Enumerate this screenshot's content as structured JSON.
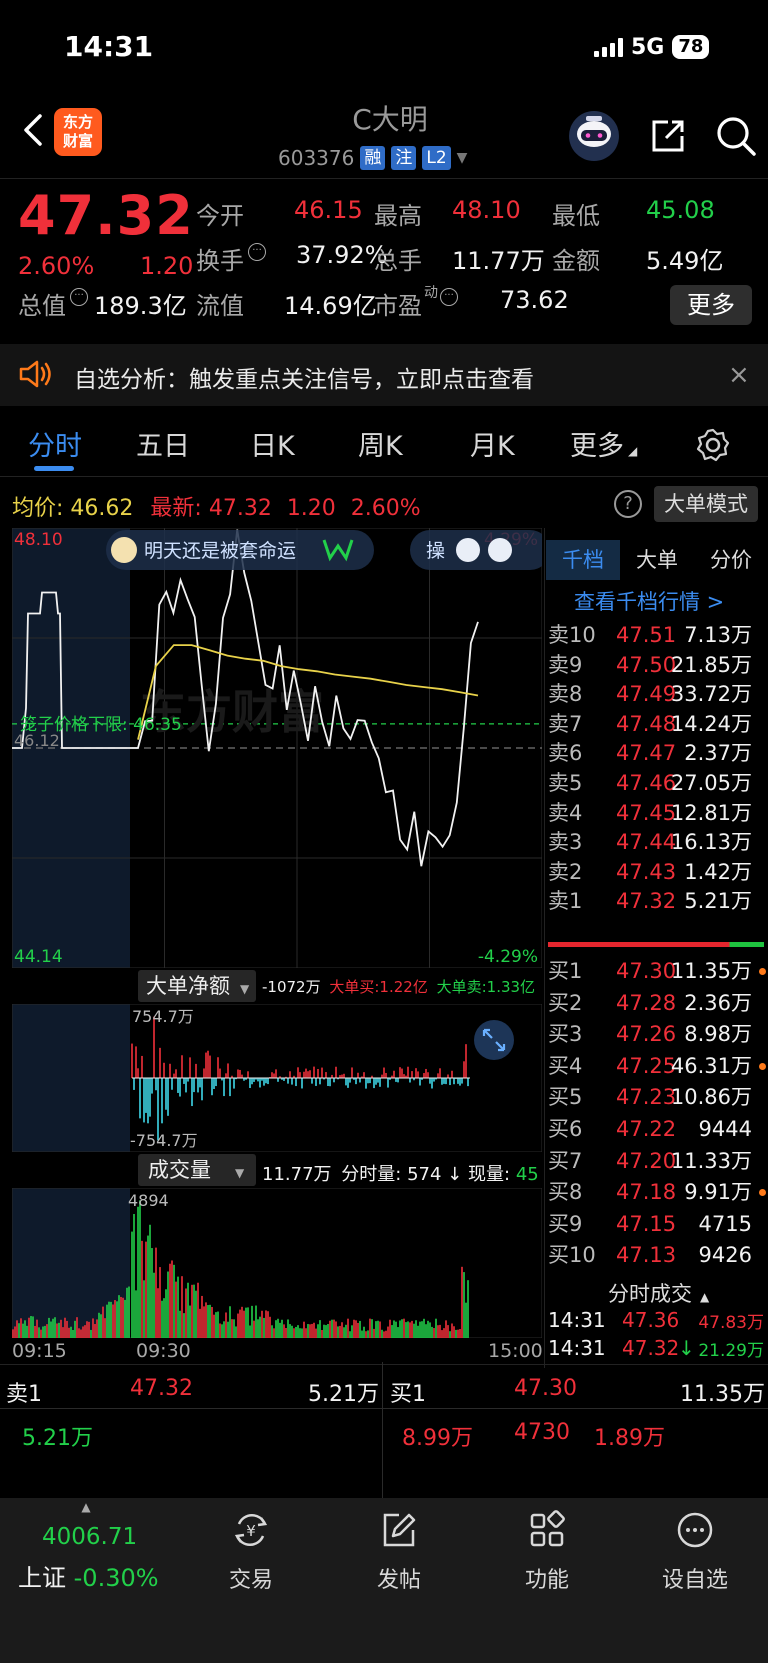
{
  "status": {
    "time": "14:31",
    "network": "5G",
    "battery": "78"
  },
  "header": {
    "app_logo": "东方\n财富",
    "stock_name": "C大明",
    "stock_code": "603376",
    "tags": [
      "融",
      "注",
      "L2"
    ],
    "icons": [
      "chevron-left-icon",
      "robot-avatar-icon",
      "share-icon",
      "search-icon"
    ]
  },
  "quote": {
    "price": "47.32",
    "change_pct": "2.60%",
    "change": "1.20",
    "fields": [
      {
        "label": "今开",
        "value": "46.15",
        "color": "red"
      },
      {
        "label": "最高",
        "value": "48.10",
        "color": "red"
      },
      {
        "label": "最低",
        "value": "45.08",
        "color": "green"
      },
      {
        "label": "换手",
        "value": "37.92%",
        "color": "white"
      },
      {
        "label": "总手",
        "value": "11.77万",
        "color": "white"
      },
      {
        "label": "金额",
        "value": "5.49亿",
        "color": "white"
      },
      {
        "label": "总值",
        "value": "189.3亿",
        "color": "white"
      },
      {
        "label": "流值",
        "value": "14.69亿",
        "color": "white"
      },
      {
        "label": "市盈",
        "value": "73.62",
        "color": "white",
        "sup": "动"
      }
    ],
    "more_label": "更多"
  },
  "alert": {
    "text": "自选分析：触发重点关注信号，立即点击查看",
    "close": "×"
  },
  "tabs": [
    {
      "label": "分时",
      "active": true
    },
    {
      "label": "五日"
    },
    {
      "label": "日K"
    },
    {
      "label": "周K"
    },
    {
      "label": "月K"
    },
    {
      "label": "更多"
    }
  ],
  "chart_header": {
    "avg_label": "均价:",
    "avg_value": "46.62",
    "last_label": "最新:",
    "last_value": "47.32",
    "last_change": "1.20",
    "last_pct": "2.60%",
    "mode_button": "大单模式"
  },
  "chart_data": [
    {
      "type": "line",
      "y_high": "48.10",
      "y_low": "44.14",
      "y_mid": "46.12",
      "pct_high": "4.29%",
      "pct_low": "-4.29%",
      "ylim": [
        44.14,
        48.1
      ],
      "xlabels": [
        "09:15",
        "09:30",
        "15:00"
      ],
      "limit_line": {
        "label": "笼子价格下限: 46.35",
        "value": 46.35
      },
      "annotation": "明天还是被套命运",
      "annotation2": "操",
      "watermark": "东方财富",
      "series": [
        {
          "values": [
            46.12,
            46.3,
            46.5,
            47.4,
            47.6,
            47.5,
            47.6,
            47.6,
            47.4,
            46.6,
            46.2,
            46.5,
            47.3,
            47.7,
            48.1,
            47.8,
            47.6,
            47.0,
            46.8,
            46.7,
            47.0,
            46.6,
            46.8,
            46.5,
            46.3,
            46.6,
            46.4,
            46.2,
            46.5,
            46.4,
            46.2,
            46.3,
            46.5,
            46.1,
            46.0,
            45.8,
            45.6,
            45.3,
            45.2,
            45.4,
            45.1,
            45.3,
            45.2,
            45.3,
            45.2,
            45.6,
            46.4,
            47.0,
            47.32
          ]
        },
        {
          "values": [
            46.2,
            46.9,
            47.1,
            47.1,
            47.05,
            47.0,
            46.97,
            46.95,
            46.9,
            46.87,
            46.85,
            46.82,
            46.8,
            46.78,
            46.75,
            46.72,
            46.7,
            46.68,
            46.65,
            46.62
          ]
        }
      ]
    },
    {
      "type": "bar",
      "title": "大单净额",
      "net": "-1072万",
      "buy": "大单买:1.22亿",
      "sell": "大单卖:1.33亿",
      "ymax_label": "754.7万",
      "ymin_label": "-754.7万",
      "ylim": [
        -754.7,
        754.7
      ]
    },
    {
      "type": "bar",
      "title": "成交量",
      "total": "11.77万",
      "minute_label": "分时量:",
      "minute_value": "574",
      "now_label": "现量:",
      "now_value": "45",
      "ymax_label": "4894",
      "ylim": [
        0,
        4894
      ]
    }
  ],
  "order_book": {
    "tabs": [
      "千档",
      "大单",
      "分价"
    ],
    "link": "查看千档行情 >",
    "asks": [
      {
        "label": "卖10",
        "price": "47.51",
        "vol": "7.13万"
      },
      {
        "label": "卖9",
        "price": "47.50",
        "vol": "21.85万"
      },
      {
        "label": "卖8",
        "price": "47.49",
        "vol": "33.72万"
      },
      {
        "label": "卖7",
        "price": "47.48",
        "vol": "14.24万"
      },
      {
        "label": "卖6",
        "price": "47.47",
        "vol": "2.37万"
      },
      {
        "label": "卖5",
        "price": "47.46",
        "vol": "27.05万"
      },
      {
        "label": "卖4",
        "price": "47.45",
        "vol": "12.81万"
      },
      {
        "label": "卖3",
        "price": "47.44",
        "vol": "16.13万"
      },
      {
        "label": "卖2",
        "price": "47.43",
        "vol": "1.42万"
      },
      {
        "label": "卖1",
        "price": "47.32",
        "vol": "5.21万"
      }
    ],
    "bids": [
      {
        "label": "买1",
        "price": "47.30",
        "vol": "11.35万",
        "dot": true
      },
      {
        "label": "买2",
        "price": "47.28",
        "vol": "2.36万"
      },
      {
        "label": "买3",
        "price": "47.26",
        "vol": "8.98万"
      },
      {
        "label": "买4",
        "price": "47.25",
        "vol": "46.31万",
        "dot": true
      },
      {
        "label": "买5",
        "price": "47.23",
        "vol": "10.86万"
      },
      {
        "label": "买6",
        "price": "47.22",
        "vol": "9444"
      },
      {
        "label": "买7",
        "price": "47.20",
        "vol": "11.33万"
      },
      {
        "label": "买8",
        "price": "47.18",
        "vol": "9.91万",
        "dot": true
      },
      {
        "label": "买9",
        "price": "47.15",
        "vol": "4715"
      },
      {
        "label": "买10",
        "price": "47.13",
        "vol": "9426"
      }
    ],
    "trades_title": "分时成交",
    "trades": [
      {
        "time": "14:31",
        "price": "47.36",
        "vol": "47.83万",
        "arrow": ""
      },
      {
        "time": "14:31",
        "price": "47.32",
        "vol": "21.29万",
        "arrow": "↓"
      }
    ]
  },
  "bottom_quote": {
    "ask_label": "卖1",
    "ask_price": "47.32",
    "ask_vol": "5.21万",
    "bid_label": "买1",
    "bid_price": "47.30",
    "bid_vol": "11.35万",
    "left_detail": "5.21万",
    "right_detail": [
      "8.99万",
      "4730",
      "1.89万"
    ]
  },
  "bottom_nav": {
    "index_value": "4006.71",
    "index_name": "上证",
    "index_pct": "-0.30%",
    "items": [
      {
        "label": "交易",
        "icon": "yen-cycle-icon"
      },
      {
        "label": "发帖",
        "icon": "edit-icon"
      },
      {
        "label": "功能",
        "icon": "grid-icon"
      },
      {
        "label": "设自选",
        "icon": "more-circle-icon"
      }
    ]
  },
  "colors": {
    "up": "#f0303a",
    "down": "#22d04a",
    "avg": "#e8d24a",
    "accent": "#3b8cf0"
  }
}
